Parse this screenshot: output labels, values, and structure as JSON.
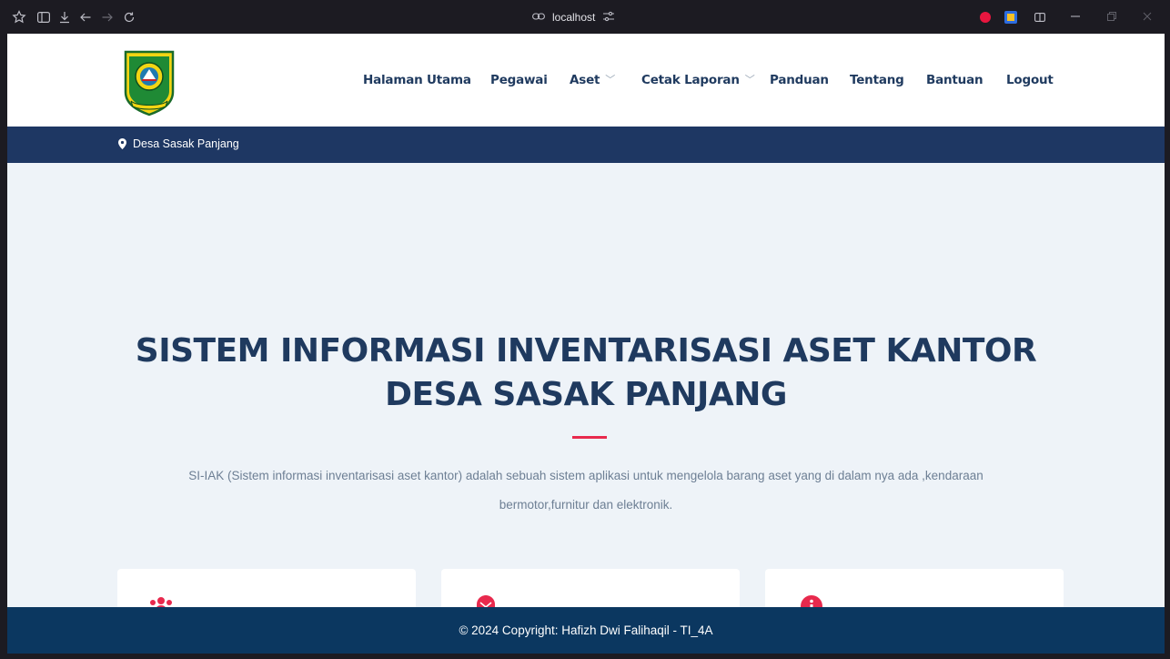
{
  "browser": {
    "url": "localhost"
  },
  "site": {
    "logo_alt": "Logo Kabupaten Bogor",
    "logo_caption": "TEGAR BERIMAN",
    "nav": [
      {
        "label": "Halaman Utama",
        "has_dropdown": false
      },
      {
        "label": "Pegawai",
        "has_dropdown": false
      },
      {
        "label": "Aset",
        "has_dropdown": true
      },
      {
        "label": "Cetak Laporan",
        "has_dropdown": true
      },
      {
        "label": "Panduan",
        "has_dropdown": false
      },
      {
        "label": "Tentang",
        "has_dropdown": false
      },
      {
        "label": "Bantuan",
        "has_dropdown": false
      },
      {
        "label": "Logout",
        "has_dropdown": false
      }
    ],
    "location": "Desa Sasak Panjang"
  },
  "hero": {
    "title_line1": "SISTEM INFORMASI INVENTARISASI ASET KANTOR",
    "title_line2": "DESA SASAK PANJANG",
    "description": "SI-IAK (Sistem informasi inventarisasi aset kantor) adalah sebuah sistem aplikasi untuk mengelola barang aset yang di dalam nya ada ,kendaraan bermotor,furnitur dan elektronik."
  },
  "cards": [
    {
      "icon": "users-icon"
    },
    {
      "icon": "envelope-icon"
    },
    {
      "icon": "info-icon"
    }
  ],
  "footer": {
    "text": "© 2024 Copyright: Hafizh Dwi Falihaqil - TI_4A"
  },
  "colors": {
    "accent": "#e8294d",
    "navy": "#1f3a5f",
    "topbar": "#1e3763",
    "footer": "#0b3760",
    "background": "#eef3f8"
  }
}
